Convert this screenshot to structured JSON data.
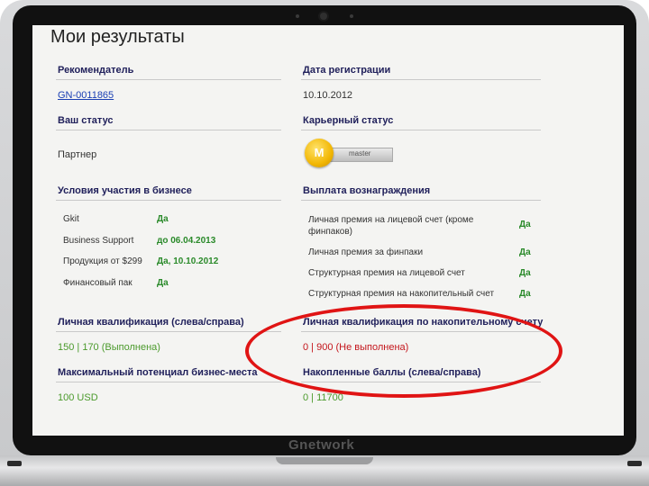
{
  "page": {
    "title": "Мои результаты"
  },
  "left_col": {
    "recommender_label": "Рекомендатель",
    "recommender_value": "GN-0011865",
    "status_label": "Ваш статус",
    "status_value": "Партнер",
    "conditions_label": "Условия участия в бизнесе",
    "conditions": [
      {
        "name": "Gkit",
        "value": "Да"
      },
      {
        "name": "Business Support",
        "value": "до 06.04.2013"
      },
      {
        "name": "Продукция от $299",
        "value": "Да, 10.10.2012"
      },
      {
        "name": "Финансовый пак",
        "value": "Да"
      }
    ],
    "personal_qual_label": "Личная квалификация (слева/справа)",
    "personal_qual_value": "150 | 170 (Выполнена)",
    "max_potential_label": "Максимальный потенциал бизнес-места",
    "max_potential_value": "100 USD"
  },
  "right_col": {
    "reg_date_label": "Дата регистрации",
    "reg_date_value": "10.10.2012",
    "career_label": "Карьерный статус",
    "career_badge_letter": "M",
    "career_badge_text": "master",
    "payments_label": "Выплата вознаграждения",
    "payments": [
      {
        "name": "Личная премия на лицевой счет (кроме финпаков)",
        "value": "Да"
      },
      {
        "name": "Личная премия за финпаки",
        "value": "Да"
      },
      {
        "name": "Структурная премия на лицевой счет",
        "value": "Да"
      },
      {
        "name": "Структурная премия на накопительный счет",
        "value": "Да"
      }
    ],
    "accum_qual_label": "Личная квалификация по накопительному счету",
    "accum_qual_value": "0 | 900 (Не выполнена)",
    "accum_points_label": "Накопленные баллы (слева/справа)",
    "accum_points_value": "0 | 11700"
  },
  "device": {
    "brand": "Gnetwork"
  },
  "colors": {
    "ellipse": "#e01414",
    "green_text": "#4b9a2c",
    "red_text": "#c4161c",
    "section_label": "#1f1f5a"
  }
}
